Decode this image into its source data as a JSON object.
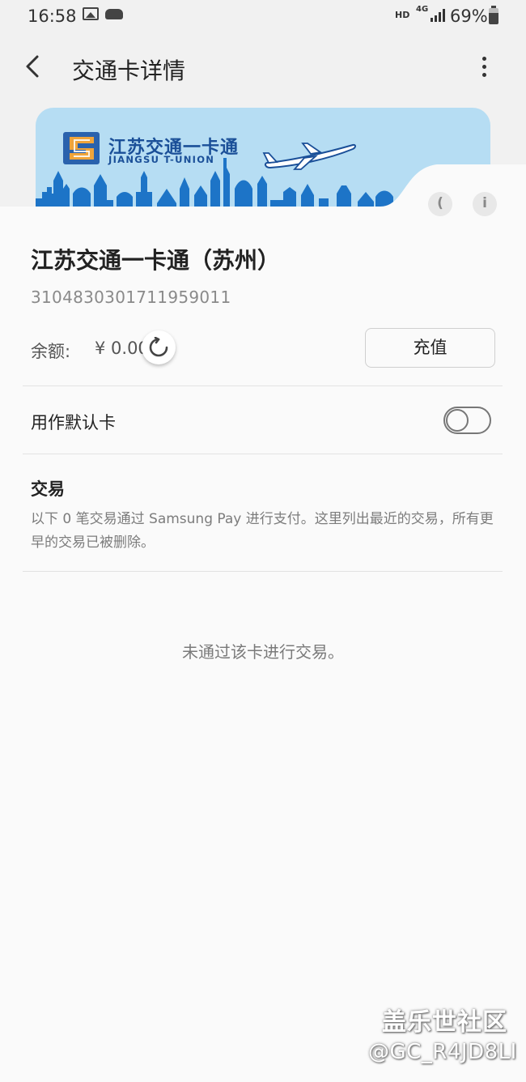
{
  "status_bar": {
    "time": "16:58",
    "hd": "HD",
    "network": "4G",
    "battery": "69%",
    "battery_level": 0.69
  },
  "app_bar": {
    "title": "交通卡详情"
  },
  "card": {
    "brand_cn": "江苏交通一卡通",
    "brand_en": "JIANGSU T-UNION",
    "colors": {
      "card_bg": "#b6ddf3",
      "brand": "#1a4f98",
      "logo_orange": "#f0a43a",
      "skyline": "#1d74c7"
    }
  },
  "card_detail": {
    "name": "江苏交通一卡通（苏州）",
    "number": "310483030171195901​1",
    "balance_label": "余额:",
    "balance_value": "¥ 0.00",
    "topup_label": "充值",
    "nfc_glyph": "(",
    "info_glyph": "i"
  },
  "default_card": {
    "label": "用作默认卡",
    "enabled": false
  },
  "transactions": {
    "title": "交易",
    "description": "以下 0 笔交易通过 Samsung Pay 进行支付。这里列出最近的交易，所有更早的交易已被删除。",
    "empty_message": "未通过该卡进行交易。"
  },
  "watermark": {
    "title": "盖乐世社区",
    "user": "@GC_R4JD8LI"
  }
}
